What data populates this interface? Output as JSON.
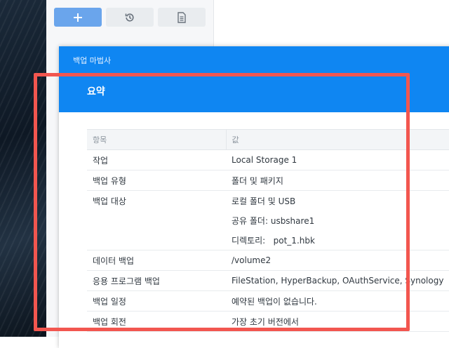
{
  "toolbar": {
    "add_icon": "plus-icon",
    "restore_icon": "history-icon",
    "log_icon": "document-icon",
    "accent": "#6aa5ec"
  },
  "dialog": {
    "title": "백업 마법사",
    "subtitle": "요약",
    "header_color": "#0f86f2"
  },
  "table": {
    "headers": {
      "key": "항목",
      "value": "값"
    },
    "rows": [
      {
        "key": "작업",
        "value": "Local Storage 1"
      },
      {
        "key": "백업 유형",
        "value": "폴더 및 패키지"
      },
      {
        "key": "백업 대상",
        "value": "로컬 폴더 및 USB"
      },
      {
        "key": "",
        "value": "공유 폴더: usbshare1"
      },
      {
        "key": "",
        "value": "디렉토리:   pot_1.hbk"
      },
      {
        "key": "데이터 백업",
        "value": "/volume2"
      },
      {
        "key": "응용 프로그램 백업",
        "value": "FileStation, HyperBackup, OAuthService, Synology"
      },
      {
        "key": "백업 일정",
        "value": "예약된 백업이 없습니다."
      },
      {
        "key": "백업 회전",
        "value": "가장 초기 버전에서"
      }
    ]
  },
  "annotation": {
    "color": "#f2564f"
  }
}
